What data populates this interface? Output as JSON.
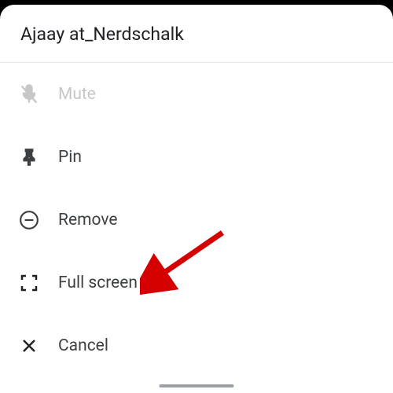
{
  "header": {
    "title": "Ajaay at_Nerdschalk"
  },
  "menu": {
    "mute": {
      "label": "Mute",
      "disabled": true
    },
    "pin": {
      "label": "Pin"
    },
    "remove": {
      "label": "Remove"
    },
    "fullscreen": {
      "label": "Full screen"
    },
    "cancel": {
      "label": "Cancel"
    }
  },
  "colors": {
    "arrow": "#d50000",
    "text": "#3c4043",
    "disabled": "#c7c7c7"
  }
}
